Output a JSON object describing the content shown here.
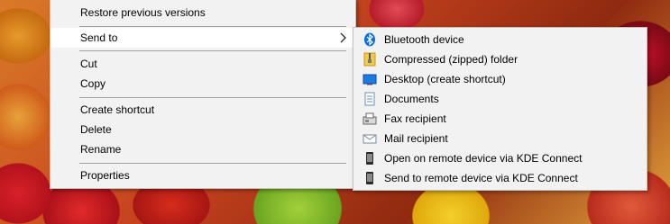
{
  "context_menu": {
    "items": [
      {
        "label": "Restore previous versions"
      },
      {
        "label": "Send to"
      },
      {
        "label": "Cut"
      },
      {
        "label": "Copy"
      },
      {
        "label": "Create shortcut"
      },
      {
        "label": "Delete"
      },
      {
        "label": "Rename"
      },
      {
        "label": "Properties"
      }
    ]
  },
  "send_to_menu": {
    "items": [
      {
        "label": "Bluetooth device",
        "icon": "bluetooth-icon"
      },
      {
        "label": "Compressed (zipped) folder",
        "icon": "zip-folder-icon"
      },
      {
        "label": "Desktop (create shortcut)",
        "icon": "desktop-icon"
      },
      {
        "label": "Documents",
        "icon": "documents-icon"
      },
      {
        "label": "Fax recipient",
        "icon": "fax-icon"
      },
      {
        "label": "Mail recipient",
        "icon": "mail-icon"
      },
      {
        "label": "Open on remote device via KDE Connect",
        "icon": "phone-icon"
      },
      {
        "label": "Send to remote device via KDE Connect",
        "icon": "phone-icon"
      }
    ]
  },
  "colors": {
    "menu_bg": "#f2f2f2",
    "highlight": "#ffffff",
    "accent": "#0a6fd8"
  }
}
